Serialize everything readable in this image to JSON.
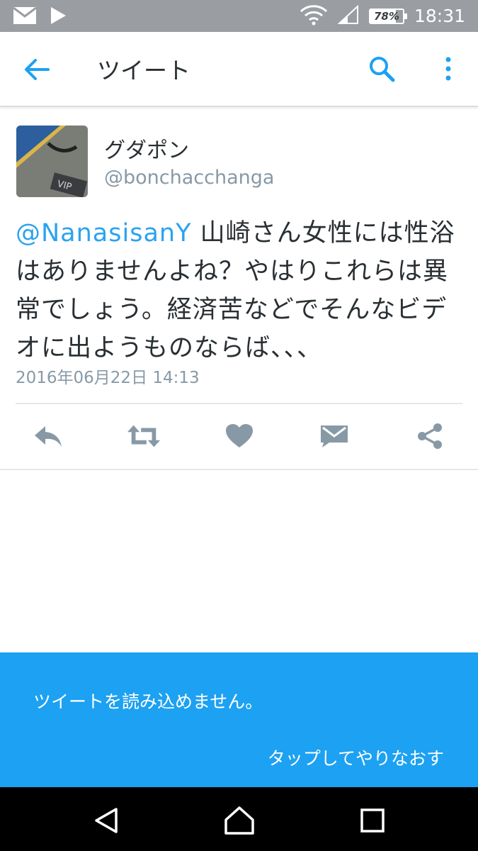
{
  "status_bar": {
    "battery_percent": "78%",
    "battery_level": 0.78,
    "time": "18:31",
    "icons": [
      "mail-icon",
      "play-store-icon",
      "wifi-icon",
      "signal-icon",
      "battery-icon"
    ]
  },
  "app_bar": {
    "title": "ツイート",
    "icons": [
      "back-arrow-icon",
      "search-icon",
      "more-vertical-icon"
    ]
  },
  "tweet": {
    "display_name": "グダポン",
    "handle": "@bonchacchanga",
    "mention": "@NanasisanY",
    "text": " 山崎さん女性には性浴はありませんよね？やはりこれらは異常でしょう。経済苦などでそんなビデオに出ようものならば、、、",
    "timestamp": "2016年06月22日 14:13",
    "avatar_text": "VIP"
  },
  "actions": [
    "reply-icon",
    "retweet-icon",
    "like-icon",
    "direct-message-icon",
    "share-icon"
  ],
  "snackbar": {
    "message": "ツイートを読み込めません。",
    "retry": "タップしてやりなおす"
  },
  "nav_bar": [
    "nav-back-icon",
    "nav-home-icon",
    "nav-recents-icon"
  ],
  "colors": {
    "accent": "#1da1f2",
    "icon_gray": "#8899a6",
    "text": "#292f33",
    "status_bar": "#9a9da1"
  }
}
